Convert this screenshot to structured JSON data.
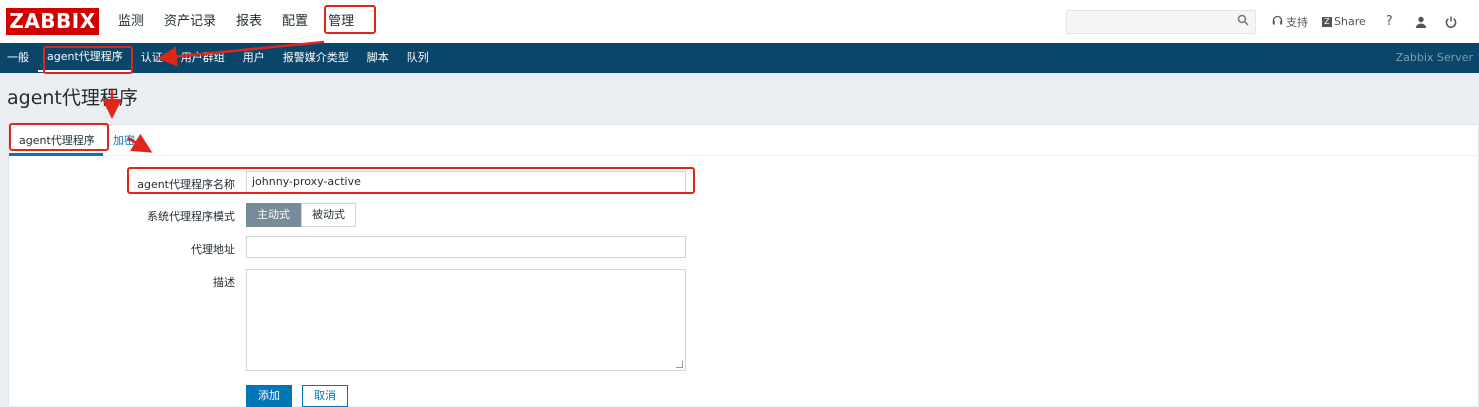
{
  "header": {
    "logo": "ZABBIX",
    "nav": [
      "监测",
      "资产记录",
      "报表",
      "配置",
      "管理"
    ],
    "search_icon": "search-icon",
    "support": "支持",
    "share": "Share",
    "help": "?",
    "user_icon": "user-icon",
    "power_icon": "power-icon"
  },
  "subnav": {
    "items": [
      "一般",
      "agent代理程序",
      "认证",
      "用户群组",
      "用户",
      "报警媒介类型",
      "脚本",
      "队列"
    ],
    "server_label": "Zabbix Server"
  },
  "page": {
    "title": "agent代理程序"
  },
  "tabs": [
    "agent代理程序",
    "加密"
  ],
  "form": {
    "name_label": "agent代理程序名称",
    "name_value": "johnny-proxy-active",
    "mode_label": "系统代理程序模式",
    "mode_options": [
      "主动式",
      "被动式"
    ],
    "mode_selected": "主动式",
    "address_label": "代理地址",
    "address_value": "",
    "desc_label": "描述",
    "desc_value": "",
    "add_button": "添加",
    "cancel_button": "取消"
  },
  "annotation_color": "#e0261c",
  "accent_color": "#0275b8"
}
